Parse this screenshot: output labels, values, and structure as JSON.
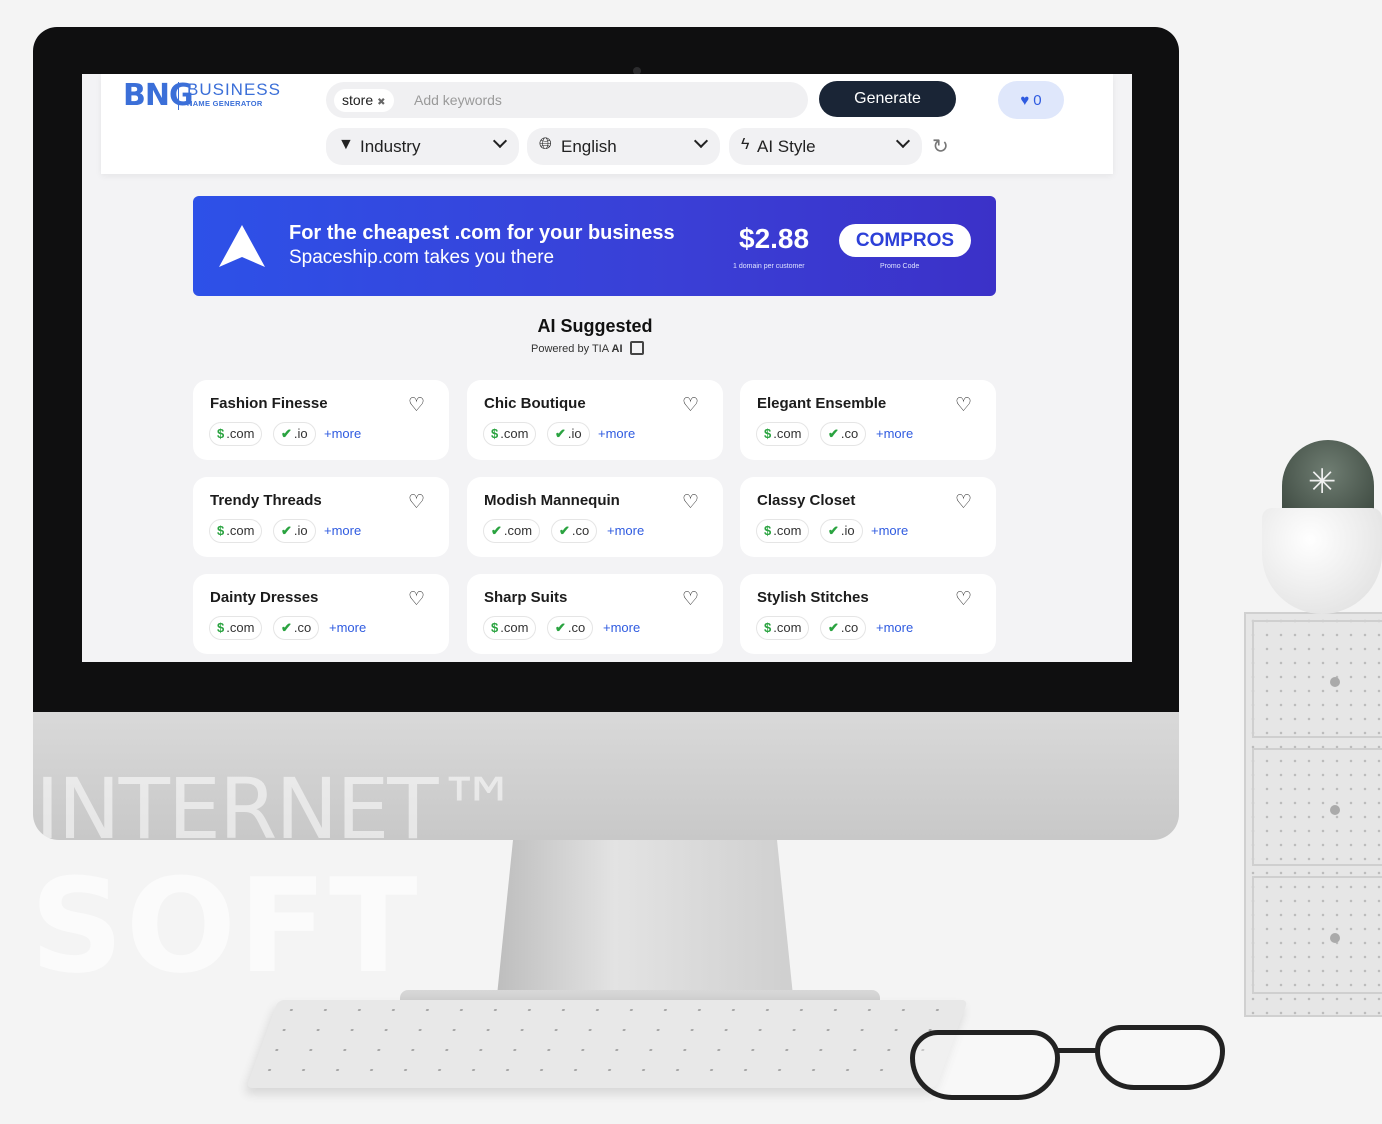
{
  "header": {
    "logo_mark": "BNG",
    "logo_line1": "BUSINESS",
    "logo_line2": "NAME GENERATOR",
    "keyword_chip": "store",
    "keyword_chip_remove": "✖",
    "keyword_placeholder": "Add keywords",
    "generate_label": "Generate",
    "favorites_count": "0",
    "filters": {
      "industry": "Industry",
      "language": "English",
      "ai_style": "AI Style"
    }
  },
  "banner": {
    "line1": "For the cheapest .com for your business",
    "line2": "Spaceship.com takes you there",
    "price": "$2.88",
    "price_note": "1 domain per customer",
    "promo_code": "COMPROS",
    "promo_note": "Promo Code"
  },
  "section": {
    "title": "AI Suggested",
    "powered_prefix": "Powered by TIA",
    "powered_ai": "AI"
  },
  "cards": [
    {
      "name": "Fashion Finesse",
      "tld1": ".com",
      "tld1_mark": "$",
      "tld2": ".io",
      "tld2_mark": "✔",
      "more": "+more"
    },
    {
      "name": "Chic Boutique",
      "tld1": ".com",
      "tld1_mark": "$",
      "tld2": ".io",
      "tld2_mark": "✔",
      "more": "+more"
    },
    {
      "name": "Elegant Ensemble",
      "tld1": ".com",
      "tld1_mark": "$",
      "tld2": ".co",
      "tld2_mark": "✔",
      "more": "+more"
    },
    {
      "name": "Trendy Threads",
      "tld1": ".com",
      "tld1_mark": "$",
      "tld2": ".io",
      "tld2_mark": "✔",
      "more": "+more"
    },
    {
      "name": "Modish Mannequin",
      "tld1": ".com",
      "tld1_mark": "✔",
      "tld2": ".co",
      "tld2_mark": "✔",
      "more": "+more"
    },
    {
      "name": "Classy Closet",
      "tld1": ".com",
      "tld1_mark": "$",
      "tld2": ".io",
      "tld2_mark": "✔",
      "more": "+more"
    },
    {
      "name": "Dainty Dresses",
      "tld1": ".com",
      "tld1_mark": "$",
      "tld2": ".co",
      "tld2_mark": "✔",
      "more": "+more"
    },
    {
      "name": "Sharp Suits",
      "tld1": ".com",
      "tld1_mark": "$",
      "tld2": ".co",
      "tld2_mark": "✔",
      "more": "+more"
    },
    {
      "name": "Stylish Stitches",
      "tld1": ".com",
      "tld1_mark": "$",
      "tld2": ".co",
      "tld2_mark": "✔",
      "more": "+more"
    }
  ],
  "watermark": {
    "line1": "INTERNET™",
    "line2": "SOFT"
  },
  "colors": {
    "accent_blue": "#2f5be0",
    "generate_bg": "#1a2536",
    "banner_start": "#2d51e8",
    "banner_end": "#3b31c8",
    "available_green": "#2aa340"
  }
}
